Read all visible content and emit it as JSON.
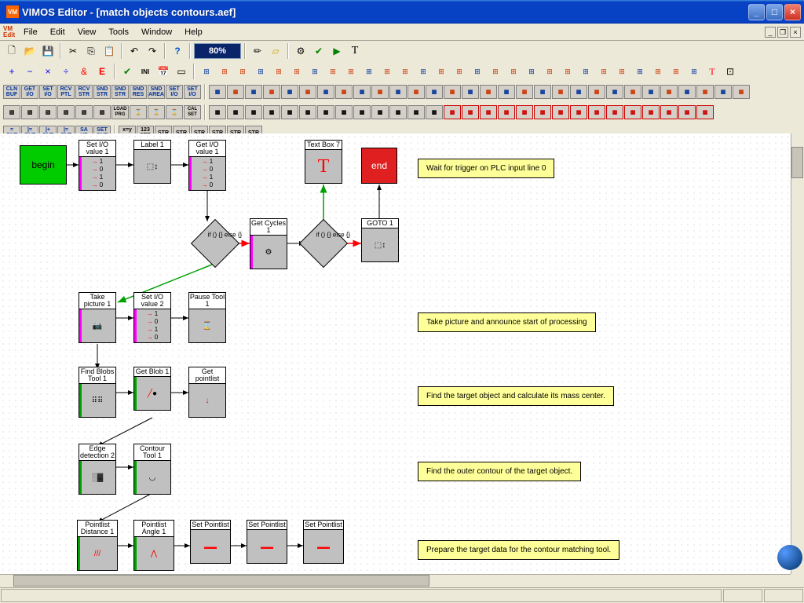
{
  "window": {
    "title": "VIMOS Editor - [match objects contours.aef]",
    "app_abbr": "VM"
  },
  "menu": [
    "File",
    "Edit",
    "View",
    "Tools",
    "Window",
    "Help"
  ],
  "zoom": "80%",
  "nodes": {
    "begin": "begin",
    "end": "end",
    "setio1": "Set I/O value 1",
    "label1": "Label 1",
    "getio1": "Get I/O value 1",
    "textbox7": "Text Box 7",
    "ifelse": "if () {} else {}",
    "getcycles": "Get Cycles 1",
    "goto1": "GOTO 1",
    "takepic": "Take picture 1",
    "setio2": "Set I/O value 2",
    "pause": "Pause Tool 1",
    "findblobs": "Find Blobs Tool 1",
    "getblob": "Get Blob 1",
    "getpointlist": "Get pointlist",
    "edgedet": "Edge detection 2",
    "contourtool": "Contour Tool 1",
    "plistdist": "Pointlist Distance 1",
    "plistangle": "Pointlist Angle 1",
    "setplist1": "Set Pointlist",
    "setplist2": "Set Pointlist",
    "setplist3": "Set Pointlist"
  },
  "callouts": {
    "c1": "Wait for trigger on PLC input line 0",
    "c2": "Take picture and announce start of processing",
    "c3": "Find the target object and calculate its mass center.",
    "c4": "Find the outer contour of the target object.",
    "c5": "Prepare the target data for the contour matching tool."
  }
}
